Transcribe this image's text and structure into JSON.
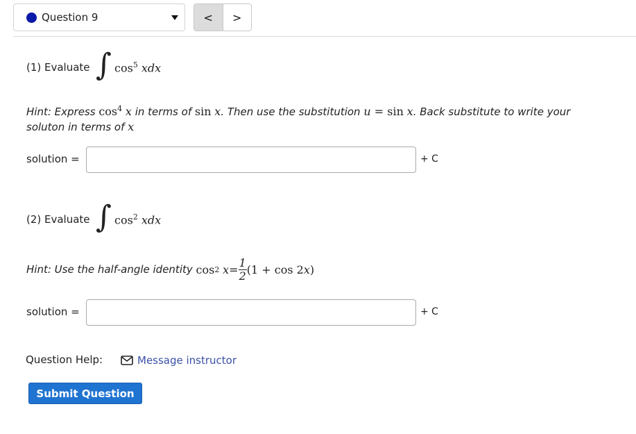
{
  "header": {
    "question_label": "Question 9",
    "prev_label": "<",
    "next_label": ">"
  },
  "part1": {
    "label": "(1) Evaluate",
    "integrand_func": "cos",
    "integrand_power": "5",
    "integrand_var": "xdx",
    "hint_prefix": "Hint: Express ",
    "hint_cos": "cos",
    "hint_cos_power": "4",
    "hint_x": "x",
    "hint_mid1": " in terms of ",
    "hint_sin": "sin",
    "hint_sinx": "x",
    "hint_mid2": ". Then use the substitution ",
    "hint_u": "u",
    "hint_eq": " = ",
    "hint_sin2": "sin",
    "hint_sinx2": "x",
    "hint_mid3": ". Back substitute to write your",
    "hint_line2": "soluton in terms of ",
    "hint_line2_var": "x",
    "solution_label": "solution =",
    "solution_value": "",
    "plus_c": "+ C"
  },
  "part2": {
    "label": "(2) Evaluate",
    "integrand_func": "cos",
    "integrand_power": "2",
    "integrand_var": "xdx",
    "hint_prefix": "Hint: Use the half-angle identity ",
    "hint_cos": "cos",
    "hint_cos_power": "2",
    "hint_x": "x",
    "hint_eq": " = ",
    "frac_num": "1",
    "frac_den": "2",
    "hint_paren": "(1 + cos 2",
    "hint_paren_var": "x",
    "hint_paren_close": ")",
    "solution_label": "solution =",
    "solution_value": "",
    "plus_c": "+ C"
  },
  "help": {
    "label": "Question Help:",
    "message_link": "Message instructor",
    "icon": "mail-icon"
  },
  "submit_label": "Submit Question",
  "colors": {
    "accent": "#1f73d1",
    "link": "#3a4fa8",
    "question_dot": "#0a1aa8"
  }
}
